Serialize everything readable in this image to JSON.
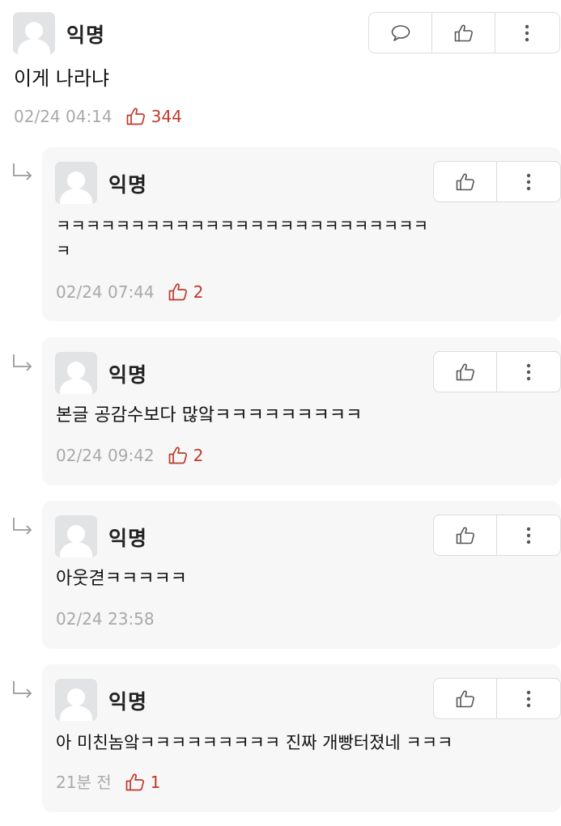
{
  "post": {
    "author": "익명",
    "text": "이게 나라냐",
    "date": "02/24 04:14",
    "likes": "344",
    "actions": [
      "comment-icon",
      "thumbs-up-icon",
      "more-icon"
    ]
  },
  "replies": [
    {
      "author": "익명",
      "text_line1": "ㅋㅋㅋㅋㅋㅋㅋㅋㅋㅋㅋㅋㅋㅋㅋㅋㅋㅋㅋㅋㅋㅋㅋㅋㅋ",
      "text_line2": "ㅋ",
      "date": "02/24 07:44",
      "likes": "2"
    },
    {
      "author": "익명",
      "text_line1": "본글 공감수보다 많앜ㅋㅋㅋㅋㅋㅋㅋㅋㅋ",
      "date": "02/24 09:42",
      "likes": "2"
    },
    {
      "author": "익명",
      "text_line1": "아웃겯ㅋㅋㅋㅋㅋ",
      "date": "02/24 23:58"
    },
    {
      "author": "익명",
      "text_line1": "아 미친놈앜ㅋㅋㅋㅋㅋㅋㅋㅋㅋ 진짜 개빵터졌네 ㅋㅋㅋ",
      "date": "21분 전",
      "likes": "1"
    }
  ],
  "colors": {
    "like": "#c0392b",
    "meta": "#a9a9a9",
    "card": "#f7f7f7"
  }
}
